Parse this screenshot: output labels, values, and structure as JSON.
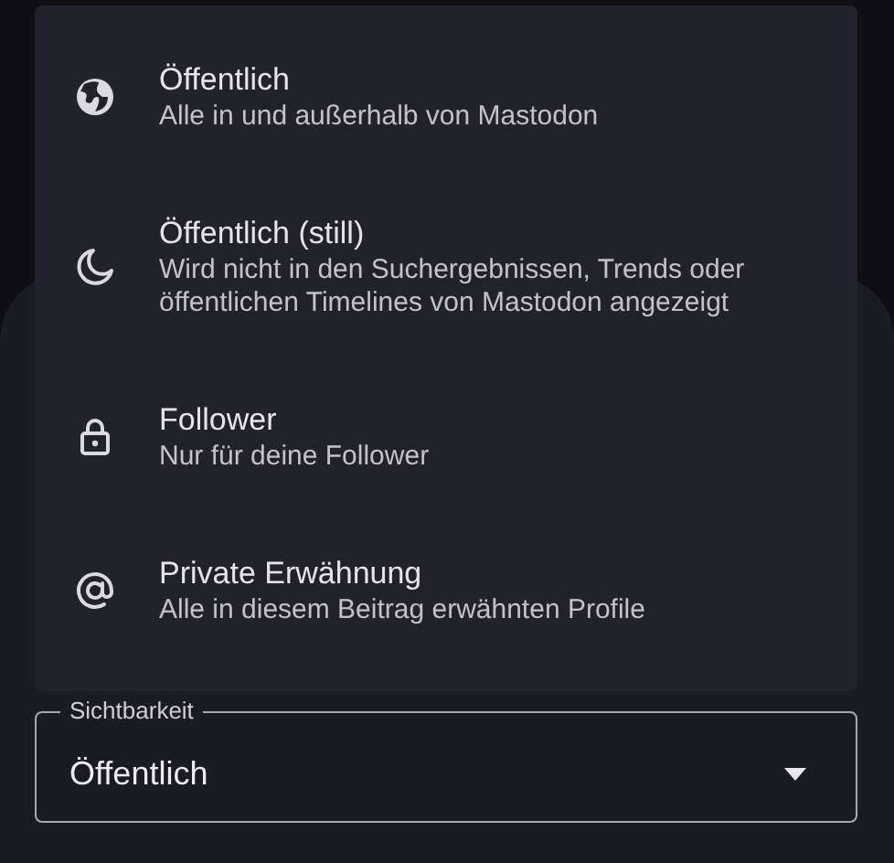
{
  "menu": {
    "items": [
      {
        "kind": "globe",
        "title": "Öffentlich",
        "subtitle": "Alle in und außerhalb von Mastodon"
      },
      {
        "kind": "moon",
        "title": "Öffentlich (still)",
        "subtitle": "Wird nicht in den Suchergebnissen, Trends oder öffentlichen Timelines von Mastodon angezeigt"
      },
      {
        "kind": "lock",
        "title": "Follower",
        "subtitle": "Nur für deine Follower"
      },
      {
        "kind": "at",
        "title": "Private Erwähnung",
        "subtitle": "Alle in diesem Beitrag erwähnten Profile"
      }
    ]
  },
  "field": {
    "label": "Sichtbarkeit",
    "value": "Öffentlich"
  }
}
